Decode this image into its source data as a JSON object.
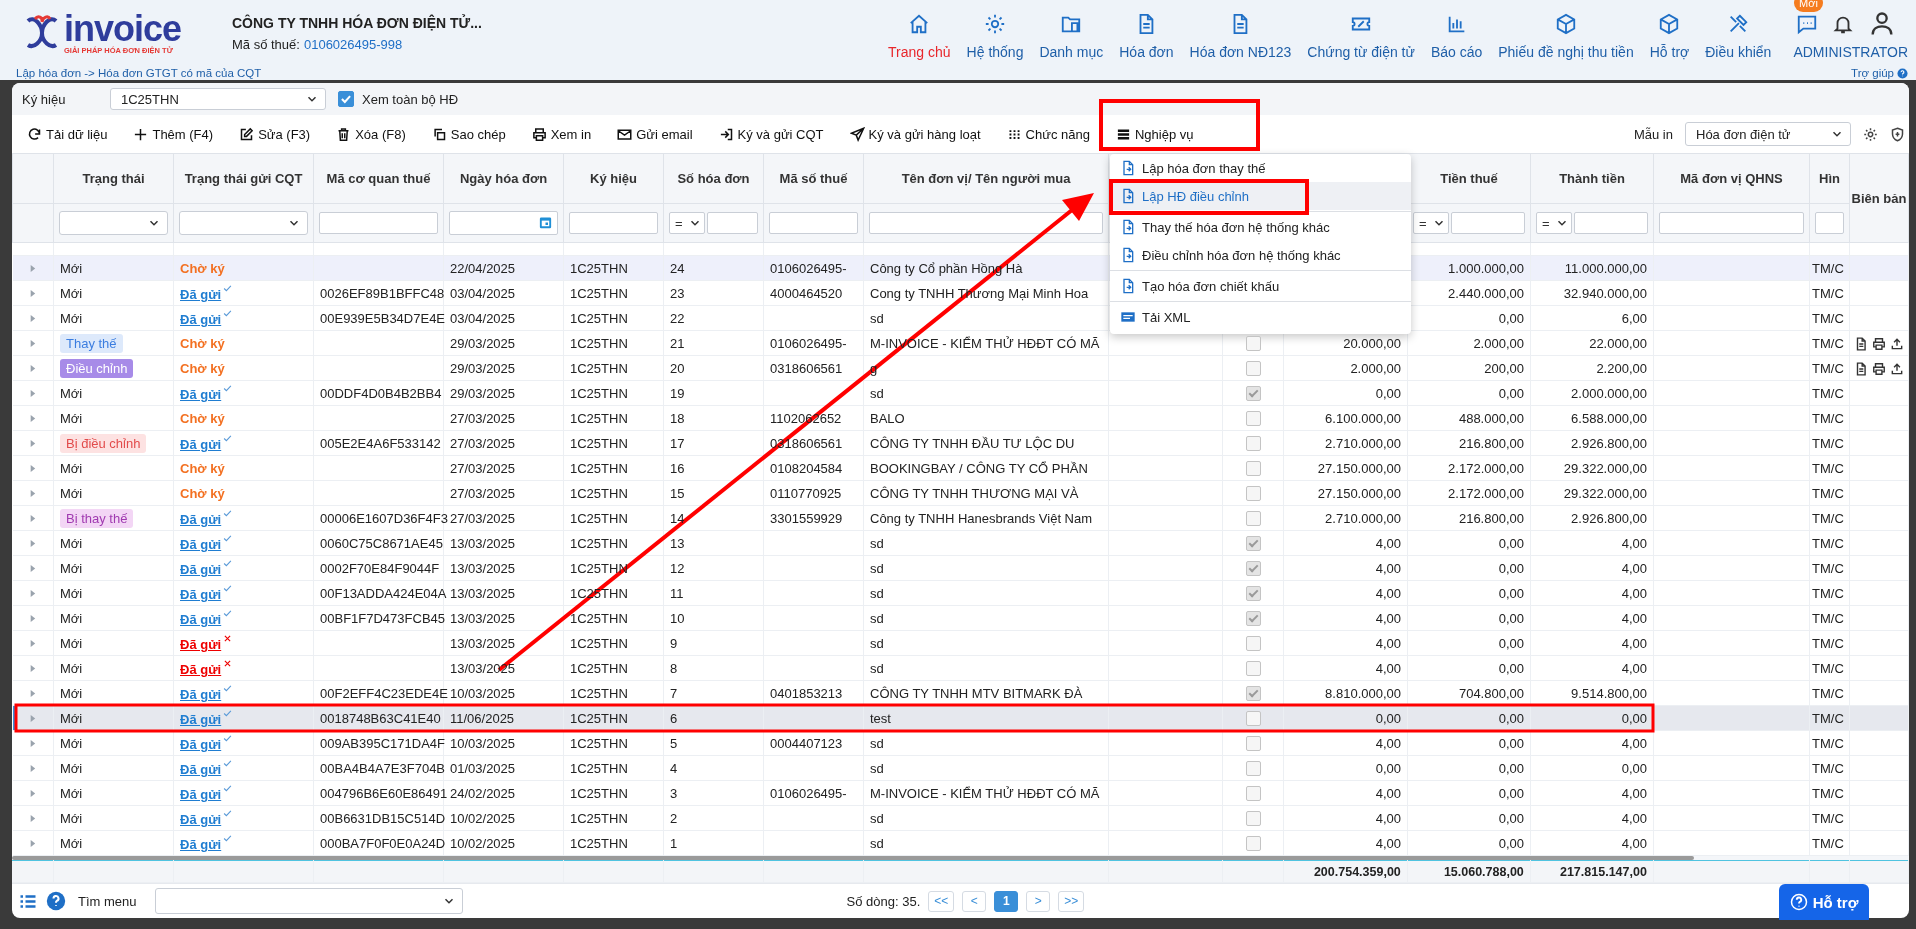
{
  "header": {
    "logo_text": "invoice",
    "logo_tagline": "GIẢI PHÁP HÓA ĐƠN ĐIỆN TỬ",
    "company": "CÔNG TY TNHH HÓA ĐƠN ĐIỆN TỬ...",
    "tax_label": "Mã số thuế:",
    "tax_code": "0106026495-998",
    "breadcrumb": "Lập hóa đơn -> Hóa đơn GTGT có mã của CQT",
    "help": "Trợ giúp",
    "user": "ADMINISTRATOR",
    "badge": "Mới"
  },
  "nav": [
    {
      "label": "Trang chủ",
      "selected": true
    },
    {
      "label": "Hệ thống",
      "selected": false
    },
    {
      "label": "Danh mục",
      "selected": false
    },
    {
      "label": "Hóa đơn",
      "selected": false
    },
    {
      "label": "Hóa đơn NĐ123",
      "selected": false
    },
    {
      "label": "Chứng từ điện tử",
      "selected": false
    },
    {
      "label": "Báo cáo",
      "selected": false
    },
    {
      "label": "Phiếu đề nghị thu tiền",
      "selected": false
    },
    {
      "label": "Hỗ trợ",
      "selected": false
    },
    {
      "label": "Điều khiển",
      "selected": false
    }
  ],
  "filter_bar": {
    "label": "Ký hiệu",
    "value": "1C25THN",
    "view_all": {
      "label": "Xem toàn bộ HĐ",
      "checked": true
    }
  },
  "toolbar": [
    "Tải dữ liệu",
    "Thêm (F4)",
    "Sửa (F3)",
    "Xóa (F8)",
    "Sao chép",
    "Xem in",
    "Gửi email",
    "Ký và gửi CQT",
    "Ký và gửi hàng loạt",
    "Chức năng",
    "Nghiệp vụ"
  ],
  "print_template": {
    "label": "Mẫu in",
    "value": "Hóa đơn điện tử"
  },
  "menu": [
    {
      "label": "Lập hóa đơn thay thế",
      "kind": "doc",
      "divider_before": false,
      "selected": false
    },
    {
      "label": "Lập HĐ điều chỉnh",
      "kind": "doc",
      "divider_before": false,
      "selected": true
    },
    {
      "label": "Thay thế hóa đơn hệ thống khác",
      "kind": "doc",
      "divider_before": true,
      "selected": false
    },
    {
      "label": "Điều chỉnh hóa đơn hệ thống khác",
      "kind": "doc",
      "divider_before": false,
      "selected": false
    },
    {
      "label": "Tạo hóa đơn chiết khấu",
      "kind": "doc",
      "divider_before": true,
      "selected": false
    },
    {
      "label": "Tải XML",
      "kind": "xml",
      "divider_before": true,
      "selected": false
    }
  ],
  "table": {
    "columns": [
      {
        "label": "Trạng thái",
        "kind": "select"
      },
      {
        "label": "Trạng thái gửi CQT",
        "kind": "select"
      },
      {
        "label": "Mã cơ quan thuế",
        "kind": "text"
      },
      {
        "label": "Ngày hóa đơn",
        "kind": "date"
      },
      {
        "label": "Ký hiệu",
        "kind": "text"
      },
      {
        "label": "Số hóa đơn",
        "kind": "number",
        "operator": "="
      },
      {
        "label": "Mã số thuế",
        "kind": "text"
      },
      {
        "label": "Tên đơn vị/ Tên người mua",
        "kind": "text"
      },
      {
        "kind": "none"
      },
      {
        "kind": "none"
      },
      {
        "kind": "none"
      },
      {
        "label": "Tiền thuế",
        "kind": "number",
        "operator": "="
      },
      {
        "label": "Thành tiền",
        "kind": "number",
        "operator": "="
      },
      {
        "label": "Mã đơn vị QHNS",
        "kind": "text"
      },
      {
        "label": "Hìn",
        "kind": "text"
      },
      {
        "label": "Biên bản",
        "kind": "none"
      }
    ],
    "rows": [
      {
        "status": {
          "text": "Mới",
          "kind": "plain"
        },
        "cqt": {
          "text": "Chờ ký",
          "kind": "pending"
        },
        "date": "22/04/2025",
        "symbol": "1C25THN",
        "number": "24",
        "tax_id": "0106026495-",
        "buyer": "Công ty Cổ phần Hồng Hà",
        "tax_amount": "1.000.000,00",
        "total": "11.000.000,00",
        "form": "TM/C",
        "highlighted": true,
        "selected": false,
        "report_actions": false
      },
      {
        "status": {
          "text": "Mới",
          "kind": "plain"
        },
        "cqt": {
          "text": "Đã gửi",
          "kind": "sent"
        },
        "code": "0026EF89B1BFFC48",
        "date": "03/04/2025",
        "symbol": "1C25THN",
        "number": "23",
        "tax_id": "4000464520",
        "buyer": "Cong ty TNHH Thương Mại Minh Hoa",
        "tax_amount": "2.440.000,00",
        "total": "32.940.000,00",
        "form": "TM/C",
        "highlighted": false,
        "selected": false,
        "report_actions": false
      },
      {
        "status": {
          "text": "Mới",
          "kind": "plain"
        },
        "cqt": {
          "text": "Đã gửi",
          "kind": "sent"
        },
        "code": "00E939E5B34D7E4E",
        "date": "03/04/2025",
        "symbol": "1C25THN",
        "number": "22",
        "buyer": "sd",
        "tax_amount": "0,00",
        "total": "6,00",
        "form": "TM/C",
        "highlighted": false,
        "selected": false,
        "report_actions": false
      },
      {
        "status": {
          "text": "Thay thế",
          "kind": "replacement"
        },
        "cqt": {
          "text": "Chờ ký",
          "kind": "pending"
        },
        "date": "29/03/2025",
        "symbol": "1C25THN",
        "number": "21",
        "tax_id": "0106026495-",
        "buyer": "M-INVOICE - KIỂM THỬ HĐĐT CÓ MÃ",
        "checked": false,
        "goods_amount": "20.000,00",
        "tax_amount": "2.000,00",
        "total": "22.000,00",
        "form": "TM/C",
        "highlighted": false,
        "selected": false,
        "report_actions": true
      },
      {
        "status": {
          "text": "Điều chỉnh",
          "kind": "adjustment"
        },
        "cqt": {
          "text": "Chờ ký",
          "kind": "pending"
        },
        "date": "29/03/2025",
        "symbol": "1C25THN",
        "number": "20",
        "tax_id": "0318606561",
        "buyer": "g",
        "checked": false,
        "goods_amount": "2.000,00",
        "tax_amount": "200,00",
        "total": "2.200,00",
        "form": "TM/C",
        "highlighted": false,
        "selected": false,
        "report_actions": true
      },
      {
        "status": {
          "text": "Mới",
          "kind": "plain"
        },
        "cqt": {
          "text": "Đã gửi",
          "kind": "sent"
        },
        "code": "00DDF4D0B4B2BB4",
        "date": "29/03/2025",
        "symbol": "1C25THN",
        "number": "19",
        "buyer": "sd",
        "checked": true,
        "goods_amount": "0,00",
        "tax_amount": "0,00",
        "total": "2.000.000,00",
        "form": "TM/C",
        "highlighted": false,
        "selected": false,
        "report_actions": false
      },
      {
        "status": {
          "text": "Mới",
          "kind": "plain"
        },
        "cqt": {
          "text": "Chờ ký",
          "kind": "pending"
        },
        "date": "27/03/2025",
        "symbol": "1C25THN",
        "number": "18",
        "tax_id": "1102062652",
        "buyer": "BALO",
        "checked": false,
        "goods_amount": "6.100.000,00",
        "tax_amount": "488.000,00",
        "total": "6.588.000,00",
        "form": "TM/C",
        "highlighted": false,
        "selected": false,
        "report_actions": false
      },
      {
        "status": {
          "text": "Bị điều chỉnh",
          "kind": "adjusted"
        },
        "cqt": {
          "text": "Đã gửi",
          "kind": "sent"
        },
        "code": "005E2E4A6F533142",
        "date": "27/03/2025",
        "symbol": "1C25THN",
        "number": "17",
        "tax_id": "0318606561",
        "buyer": "CÔNG TY TNHH ĐẦU TƯ LỘC DU",
        "checked": false,
        "goods_amount": "2.710.000,00",
        "tax_amount": "216.800,00",
        "total": "2.926.800,00",
        "form": "TM/C",
        "highlighted": false,
        "selected": false,
        "report_actions": false
      },
      {
        "status": {
          "text": "Mới",
          "kind": "plain"
        },
        "cqt": {
          "text": "Chờ ký",
          "kind": "pending"
        },
        "date": "27/03/2025",
        "symbol": "1C25THN",
        "number": "16",
        "tax_id": "0108204584",
        "buyer": "BOOKINGBAY / CÔNG TY CỔ PHẦN",
        "checked": false,
        "goods_amount": "27.150.000,00",
        "tax_amount": "2.172.000,00",
        "total": "29.322.000,00",
        "form": "TM/C",
        "highlighted": false,
        "selected": false,
        "report_actions": false
      },
      {
        "status": {
          "text": "Mới",
          "kind": "plain"
        },
        "cqt": {
          "text": "Chờ ký",
          "kind": "pending"
        },
        "date": "27/03/2025",
        "symbol": "1C25THN",
        "number": "15",
        "tax_id": "0110770925",
        "buyer": "CÔNG TY TNHH THƯƠNG MẠI VÀ",
        "checked": false,
        "goods_amount": "27.150.000,00",
        "tax_amount": "2.172.000,00",
        "total": "29.322.000,00",
        "form": "TM/C",
        "highlighted": false,
        "selected": false,
        "report_actions": false
      },
      {
        "status": {
          "text": "Bị thay thế",
          "kind": "replaced"
        },
        "cqt": {
          "text": "Đã gửi",
          "kind": "sent"
        },
        "code": "00006E1607D36F4F3",
        "date": "27/03/2025",
        "symbol": "1C25THN",
        "number": "14",
        "tax_id": "3301559929",
        "buyer": "Công ty TNHH Hanesbrands Việt Nam",
        "checked": false,
        "goods_amount": "2.710.000,00",
        "tax_amount": "216.800,00",
        "total": "2.926.800,00",
        "form": "TM/C",
        "highlighted": false,
        "selected": false,
        "report_actions": false
      },
      {
        "status": {
          "text": "Mới",
          "kind": "plain"
        },
        "cqt": {
          "text": "Đã gửi",
          "kind": "sent"
        },
        "code": "0060C75C8671AE45",
        "date": "13/03/2025",
        "symbol": "1C25THN",
        "number": "13",
        "buyer": "sd",
        "checked": true,
        "goods_amount": "4,00",
        "tax_amount": "0,00",
        "total": "4,00",
        "form": "TM/C",
        "highlighted": false,
        "selected": false,
        "report_actions": false
      },
      {
        "status": {
          "text": "Mới",
          "kind": "plain"
        },
        "cqt": {
          "text": "Đã gửi",
          "kind": "sent"
        },
        "code": "0002F70E84F9044F",
        "date": "13/03/2025",
        "symbol": "1C25THN",
        "number": "12",
        "buyer": "sd",
        "checked": true,
        "goods_amount": "4,00",
        "tax_amount": "0,00",
        "total": "4,00",
        "form": "TM/C",
        "highlighted": false,
        "selected": false,
        "report_actions": false
      },
      {
        "status": {
          "text": "Mới",
          "kind": "plain"
        },
        "cqt": {
          "text": "Đã gửi",
          "kind": "sent"
        },
        "code": "00F13ADDA424E04A",
        "date": "13/03/2025",
        "symbol": "1C25THN",
        "number": "11",
        "buyer": "sd",
        "checked": true,
        "goods_amount": "4,00",
        "tax_amount": "0,00",
        "total": "4,00",
        "form": "TM/C",
        "highlighted": false,
        "selected": false,
        "report_actions": false
      },
      {
        "status": {
          "text": "Mới",
          "kind": "plain"
        },
        "cqt": {
          "text": "Đã gửi",
          "kind": "sent"
        },
        "code": "00BF1F7D473FCB45",
        "date": "13/03/2025",
        "symbol": "1C25THN",
        "number": "10",
        "buyer": "sd",
        "checked": true,
        "goods_amount": "4,00",
        "tax_amount": "0,00",
        "total": "4,00",
        "form": "TM/C",
        "highlighted": false,
        "selected": false,
        "report_actions": false
      },
      {
        "status": {
          "text": "Mới",
          "kind": "plain"
        },
        "cqt": {
          "text": "Đã gửi",
          "kind": "failed"
        },
        "date": "13/03/2025",
        "symbol": "1C25THN",
        "number": "9",
        "buyer": "sd",
        "checked": false,
        "goods_amount": "4,00",
        "tax_amount": "0,00",
        "total": "4,00",
        "form": "TM/C",
        "highlighted": false,
        "selected": false,
        "report_actions": false
      },
      {
        "status": {
          "text": "Mới",
          "kind": "plain"
        },
        "cqt": {
          "text": "Đã gửi",
          "kind": "failed"
        },
        "date": "13/03/2025",
        "symbol": "1C25THN",
        "number": "8",
        "buyer": "sd",
        "checked": false,
        "goods_amount": "4,00",
        "tax_amount": "0,00",
        "total": "4,00",
        "form": "TM/C",
        "highlighted": false,
        "selected": false,
        "report_actions": false
      },
      {
        "status": {
          "text": "Mới",
          "kind": "plain"
        },
        "cqt": {
          "text": "Đã gửi",
          "kind": "sent"
        },
        "code": "00F2EFF4C23EDE4E",
        "date": "10/03/2025",
        "symbol": "1C25THN",
        "number": "7",
        "tax_id": "0401853213",
        "buyer": "CÔNG TY TNHH MTV BITMARK ĐÀ",
        "checked": true,
        "goods_amount": "8.810.000,00",
        "tax_amount": "704.800,00",
        "total": "9.514.800,00",
        "form": "TM/C",
        "highlighted": false,
        "selected": false,
        "report_actions": false
      },
      {
        "status": {
          "text": "Mới",
          "kind": "plain"
        },
        "cqt": {
          "text": "Đã gửi",
          "kind": "sent"
        },
        "code": "0018748B63C41E40",
        "date": "11/06/2025",
        "symbol": "1C25THN",
        "number": "6",
        "buyer": "test",
        "checked": false,
        "goods_amount": "0,00",
        "tax_amount": "0,00",
        "total": "0,00",
        "form": "TM/C",
        "highlighted": false,
        "selected": true,
        "report_actions": false
      },
      {
        "status": {
          "text": "Mới",
          "kind": "plain"
        },
        "cqt": {
          "text": "Đã gửi",
          "kind": "sent"
        },
        "code": "009AB395C171DA4F",
        "date": "10/03/2025",
        "symbol": "1C25THN",
        "number": "5",
        "tax_id": "0004407123",
        "buyer": "sd",
        "checked": false,
        "goods_amount": "4,00",
        "tax_amount": "0,00",
        "total": "4,00",
        "form": "TM/C",
        "highlighted": false,
        "selected": false,
        "report_actions": false
      },
      {
        "status": {
          "text": "Mới",
          "kind": "plain"
        },
        "cqt": {
          "text": "Đã gửi",
          "kind": "sent"
        },
        "code": "00BA4B4A7E3F704B",
        "date": "01/03/2025",
        "symbol": "1C25THN",
        "number": "4",
        "buyer": "sd",
        "checked": false,
        "goods_amount": "0,00",
        "tax_amount": "0,00",
        "total": "0,00",
        "form": "TM/C",
        "highlighted": false,
        "selected": false,
        "report_actions": false
      },
      {
        "status": {
          "text": "Mới",
          "kind": "plain"
        },
        "cqt": {
          "text": "Đã gửi",
          "kind": "sent"
        },
        "code": "004796B6E60E86491",
        "date": "24/02/2025",
        "symbol": "1C25THN",
        "number": "3",
        "tax_id": "0106026495-",
        "buyer": "M-INVOICE - KIỂM THỬ HĐĐT CÓ MÃ",
        "checked": false,
        "goods_amount": "4,00",
        "tax_amount": "0,00",
        "total": "4,00",
        "form": "TM/C",
        "highlighted": false,
        "selected": false,
        "report_actions": false
      },
      {
        "status": {
          "text": "Mới",
          "kind": "plain"
        },
        "cqt": {
          "text": "Đã gửi",
          "kind": "sent"
        },
        "code": "00B6631DB15C514D",
        "date": "10/02/2025",
        "symbol": "1C25THN",
        "number": "2",
        "buyer": "sd",
        "checked": false,
        "goods_amount": "4,00",
        "tax_amount": "0,00",
        "total": "4,00",
        "form": "TM/C",
        "highlighted": false,
        "selected": false,
        "report_actions": false
      },
      {
        "status": {
          "text": "Mới",
          "kind": "plain"
        },
        "cqt": {
          "text": "Đã gửi",
          "kind": "sent"
        },
        "code": "000BA7F0F0E0A24D",
        "date": "10/02/2025",
        "symbol": "1C25THN",
        "number": "1",
        "buyer": "sd",
        "checked": false,
        "goods_amount": "4,00",
        "tax_amount": "0,00",
        "total": "4,00",
        "form": "TM/C",
        "highlighted": false,
        "selected": false,
        "report_actions": false
      }
    ],
    "totals": {
      "goods_amount": "200.754.359,00",
      "tax_amount": "15.060.788,00",
      "total": "217.815.147,00"
    }
  },
  "footer": {
    "menu_search": "Tìm menu",
    "row_count": "Số dòng: 35.",
    "pages": [
      {
        "label": "<<",
        "selected": false
      },
      {
        "label": "<",
        "selected": false
      },
      {
        "label": "1",
        "selected": true
      },
      {
        "label": ">",
        "selected": false
      },
      {
        "label": ">>",
        "selected": false
      }
    ],
    "support": "Hỗ trợ"
  }
}
